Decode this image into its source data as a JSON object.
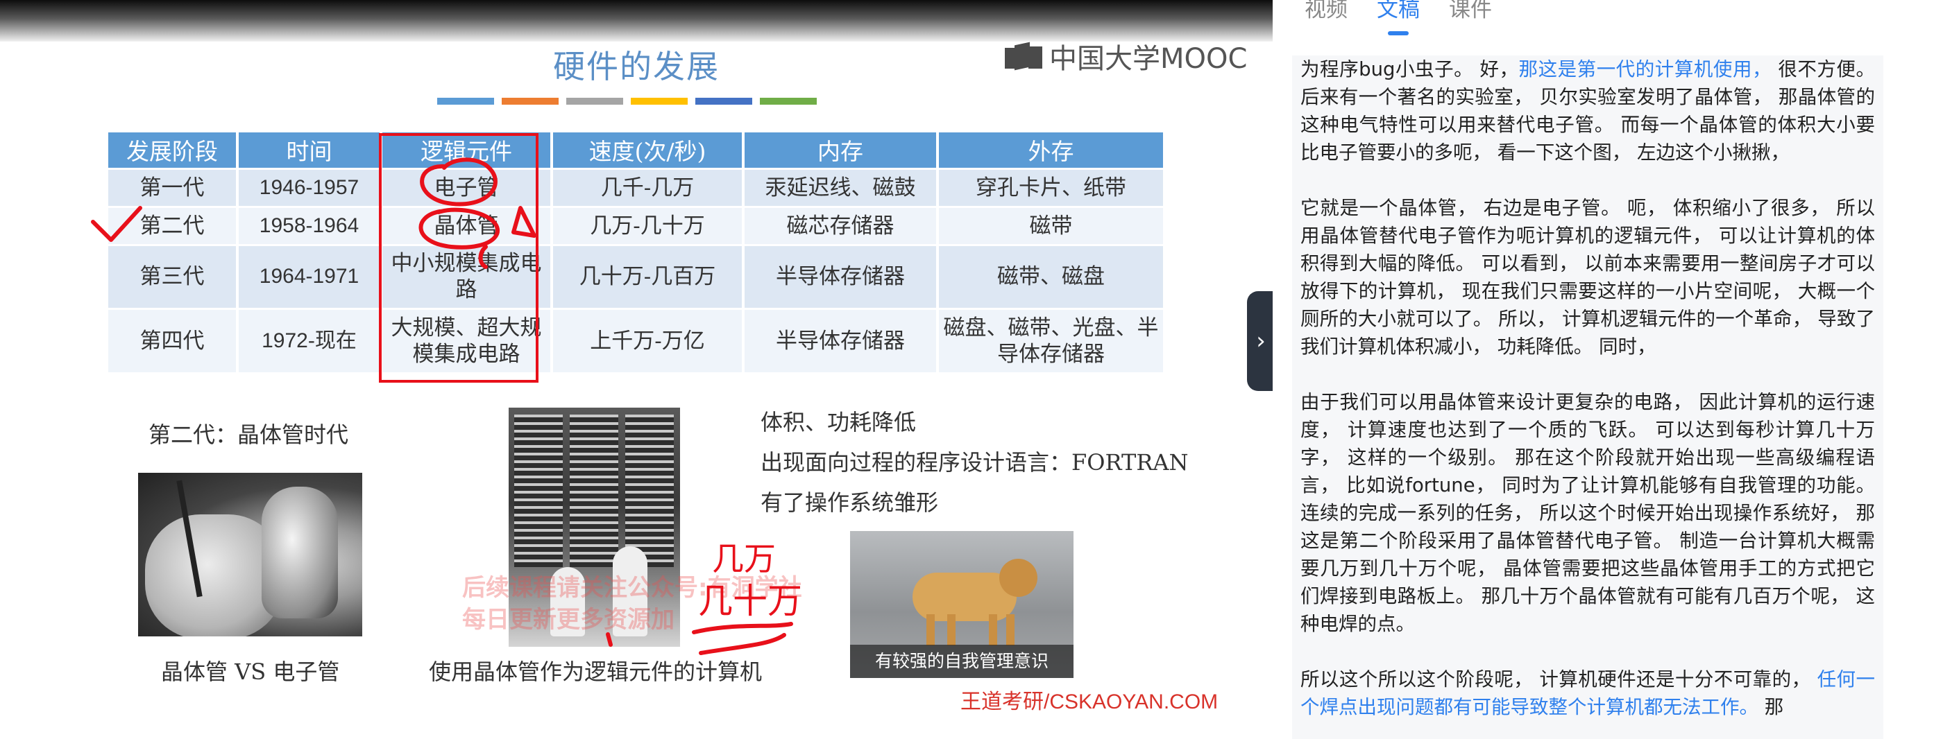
{
  "slide": {
    "title": "硬件的发展",
    "logo_text": "中国大学MOOC",
    "color_bar": [
      "#5b9bd5",
      "#ed7d31",
      "#a5a5a5",
      "#ffc000",
      "#4472c4",
      "#70ad47"
    ],
    "table": {
      "headers": [
        "发展阶段",
        "时间",
        "逻辑元件",
        "速度(次/秒)",
        "内存",
        "外存"
      ],
      "rows": [
        [
          "第一代",
          "1946-1957",
          "电子管",
          "几千-几万",
          "汞延迟线、磁鼓",
          "穿孔卡片、纸带"
        ],
        [
          "第二代",
          "1958-1964",
          "晶体管",
          "几万-几十万",
          "磁芯存储器",
          "磁带"
        ],
        [
          "第三代",
          "1964-1971",
          "中小规模集成电路",
          "几十万-几百万",
          "半导体存储器",
          "磁带、磁盘"
        ],
        [
          "第四代",
          "1972-现在",
          "大规模、超大规模集成电路",
          "上千万-万亿",
          "半导体存储器",
          "磁盘、磁带、光盘、半导体存储器"
        ]
      ]
    },
    "era_label": "第二代：晶体管时代",
    "points": [
      "体积、功耗降低",
      "出现面向过程的程序设计语言：FORTRAN",
      "有了操作系统雏形"
    ],
    "caption_left": "晶体管 VS 电子管",
    "caption_mid": "使用晶体管作为逻辑元件的计算机",
    "dog_caption": "有较强的自我管理意识",
    "watermark_1": "后续课程请关注公众号:有洞学社",
    "watermark_2": "每日更新更多资源加",
    "brand": "王道考研/CSKAOYAN.COM",
    "handwriting": [
      "几万",
      "几十万"
    ],
    "accent": "#5b9bd5",
    "annotation_color": "#e8101a"
  },
  "panel": {
    "tabs": [
      "视频",
      "文稿",
      "课件"
    ],
    "active_tab": "文稿",
    "collapse_icon": "chevron-right-icon",
    "paragraphs": [
      {
        "before": "为程序bug小虫子。 好，",
        "highlight": "那这是第一代的计算机使用，",
        "after": " 很不方便。 后来有一个著名的实验室， 贝尔实验室发明了晶体管， 那晶体管的这种电气特性可以用来替代电子管。 而每一个晶体管的体积大小要比电子管要小的多呃， 看一下这个图， 左边这个小揪揪，"
      },
      {
        "before": "它就是一个晶体管， 右边是电子管。 呃， 体积缩小了很多， 所以用晶体管替代电子管作为呃计算机的逻辑元件， 可以让计算机的体积得到大幅的降低。 可以看到， 以前本来需要用一整间房子才可以放得下的计算机， 现在我们只需要这样的一小片空间呢， 大概一个厕所的大小就可以了。 所以， 计算机逻辑元件的一个革命， 导致了我们计算机体积减小， 功耗降低。 同时，",
        "highlight": "",
        "after": ""
      },
      {
        "before": "由于我们可以用晶体管来设计更复杂的电路， 因此计算机的运行速度， 计算速度也达到了一个质的飞跃。 可以达到每秒计算几十万字， 这样的一个级别。 那在这个阶段就开始出现一些高级编程语言， 比如说fortune， 同时为了让计算机能够有自我管理的功能。 连续的完成一系列的任务， 所以这个时候开始出现操作系统好， 那这是第二个阶段采用了晶体管替代电子管。 制造一台计算机大概需要几万到几十万个呢， 晶体管需要把这些晶体管用手工的方式把它们焊接到电路板上。 那几十万个晶体管就有可能有几百万个呢， 这种电焊的点。",
        "highlight": "",
        "after": ""
      },
      {
        "before": "所以这个所以这个阶段呢， 计算机硬件还是十分不可靠的，",
        "highlight": " 任何一个焊点出现问题都有可能导致整个计算机都无法工作。",
        "after": " 那"
      }
    ]
  }
}
